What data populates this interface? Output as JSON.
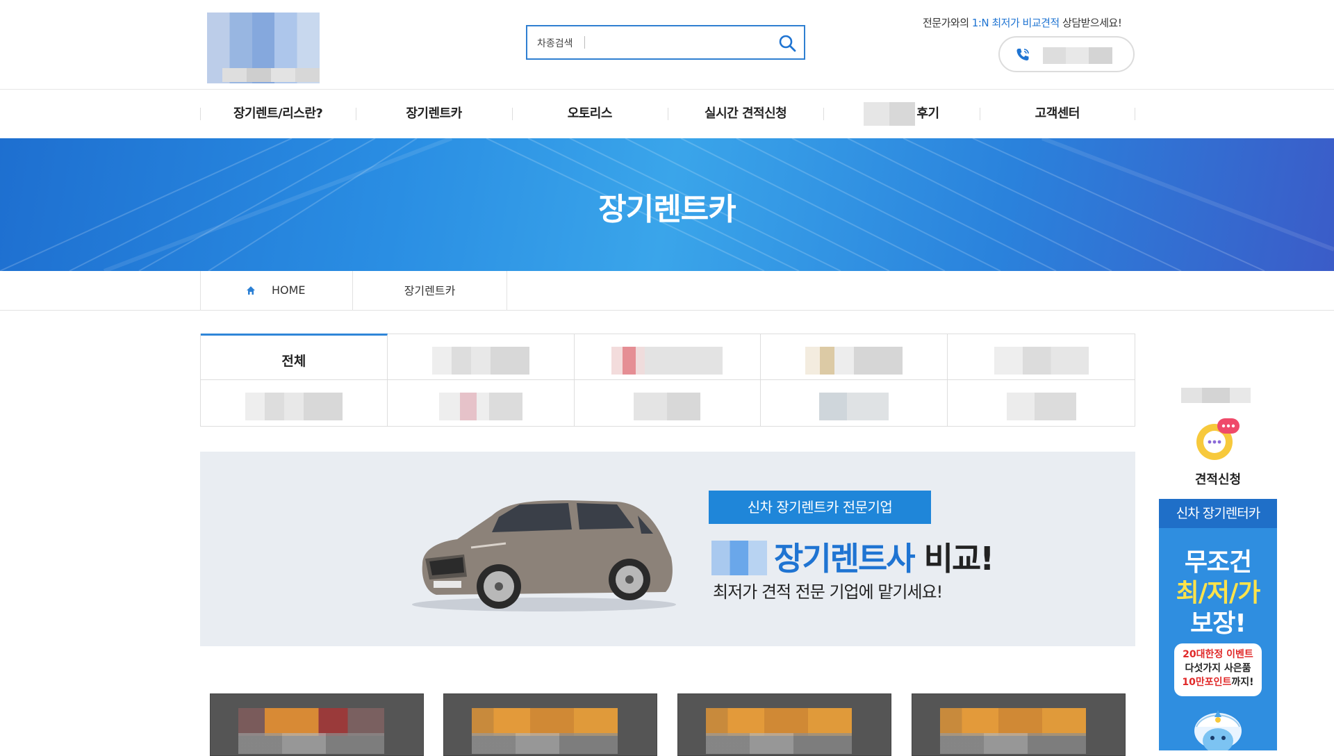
{
  "header": {
    "search": {
      "label": "차종검색",
      "placeholder": ""
    },
    "tagline": {
      "pre": "전문가와의 ",
      "highlight": "1:N 최저가 비교견적",
      "post": " 상담받으세요!"
    }
  },
  "nav": [
    {
      "label": "장기렌트/리스란?"
    },
    {
      "label": "장기렌트카"
    },
    {
      "label": "오토리스"
    },
    {
      "label": "실시간 견적신청"
    },
    {
      "label": "후기"
    },
    {
      "label": "고객센터"
    }
  ],
  "hero": {
    "title": "장기렌트카"
  },
  "breadcrumb": {
    "home": "HOME",
    "current": "장기렌트카"
  },
  "categories": {
    "active_label": "전체"
  },
  "promo": {
    "badge": "신차 장기렌트카 전문기업",
    "headline_blue": "장기렌트사",
    "headline_dark": " 비교!",
    "subline": "최저가 견적 전문 기업에 맡기세요!"
  },
  "side": {
    "quote_label": "견적신청",
    "ad_top": "신차 장기렌터카",
    "ad_line1": "무조건",
    "ad_line2": "최/저/가",
    "ad_line3": "보장!",
    "bubble_line1": "20대한정 이벤트",
    "bubble_line2": "다섯가지 사은품",
    "bubble_line3_red": "10만포인트",
    "bubble_line3_rest": "까지!"
  },
  "colors": {
    "accent": "#1f74d2",
    "hero_blue": "#2a8ee3",
    "badge_blue": "#1f86d9"
  }
}
